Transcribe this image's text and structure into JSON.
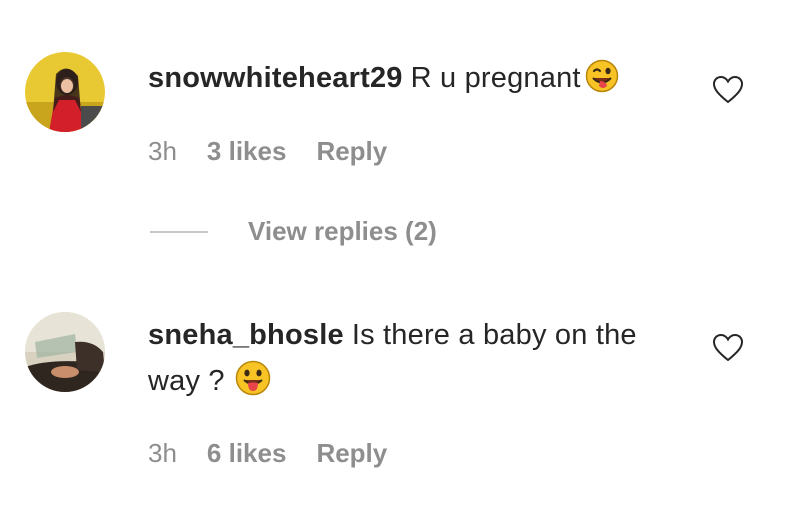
{
  "comments": [
    {
      "username": "snowwhiteheart29",
      "text": "R u pregnant",
      "emoji_icon": "winking-tongue-emoji",
      "time": "3h",
      "likes": "3 likes",
      "reply_label": "Reply"
    },
    {
      "username": "sneha_bhosle",
      "text": "Is there a baby on the way ?",
      "emoji_icon": "tongue-out-emoji",
      "time": "3h",
      "likes": "6 likes",
      "reply_label": "Reply"
    }
  ],
  "view_replies": "View replies (2)",
  "colors": {
    "text": "#262626",
    "secondary": "#8e8e8e",
    "divider": "#c7c7c7",
    "emoji": "#f7c325"
  }
}
